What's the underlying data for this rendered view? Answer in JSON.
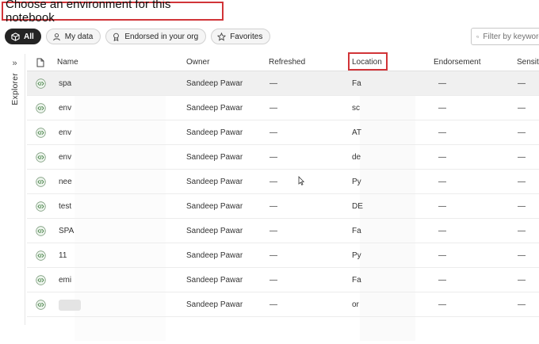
{
  "dialog": {
    "title": "Choose an environment for this notebook"
  },
  "filters": [
    {
      "label": "All",
      "icon": "cube-icon",
      "active": true
    },
    {
      "label": "My data",
      "icon": "person-icon",
      "active": false
    },
    {
      "label": "Endorsed in your org",
      "icon": "ribbon-icon",
      "active": false
    },
    {
      "label": "Favorites",
      "icon": "star-icon",
      "active": false
    }
  ],
  "search": {
    "placeholder": "Filter by keyword"
  },
  "explorer": {
    "label": "Explorer",
    "icon": "chevron-double-right-icon"
  },
  "table": {
    "columns": [
      "Name",
      "Owner",
      "Refreshed",
      "Location",
      "Endorsement",
      "Sensiti"
    ],
    "rows": [
      {
        "name": "spa",
        "owner": "Sandeep Pawar",
        "refreshed": "—",
        "location": "Fa",
        "endorsement": "—",
        "sensitivity": "—"
      },
      {
        "name": "env",
        "owner": "Sandeep Pawar",
        "refreshed": "—",
        "location": "sc",
        "endorsement": "—",
        "sensitivity": "—"
      },
      {
        "name": "env",
        "owner": "Sandeep Pawar",
        "refreshed": "—",
        "location": "AT",
        "endorsement": "—",
        "sensitivity": "—"
      },
      {
        "name": "env",
        "owner": "Sandeep Pawar",
        "refreshed": "—",
        "location": "de",
        "endorsement": "—",
        "sensitivity": "—"
      },
      {
        "name": "nee",
        "owner": "Sandeep Pawar",
        "refreshed": "—",
        "location": "Py",
        "endorsement": "—",
        "sensitivity": "—"
      },
      {
        "name": "test",
        "owner": "Sandeep Pawar",
        "refreshed": "—",
        "location": "DE",
        "endorsement": "—",
        "sensitivity": "—"
      },
      {
        "name": "SPA",
        "owner": "Sandeep Pawar",
        "refreshed": "—",
        "location": "Fa",
        "endorsement": "—",
        "sensitivity": "—"
      },
      {
        "name": "11",
        "owner": "Sandeep Pawar",
        "refreshed": "—",
        "location": "Py",
        "endorsement": "—",
        "sensitivity": "—"
      },
      {
        "name": "emi",
        "owner": "Sandeep Pawar",
        "refreshed": "—",
        "location": "Fa",
        "endorsement": "—",
        "sensitivity": "—"
      },
      {
        "name": "",
        "owner": "Sandeep Pawar",
        "refreshed": "—",
        "location": "or",
        "endorsement": "—",
        "sensitivity": "—"
      }
    ],
    "row_icon": "notebook-code-icon"
  },
  "colors": {
    "highlight": "#d13438",
    "selected_row": "#f0f0f0",
    "icon_green": "#3f7d3f"
  }
}
